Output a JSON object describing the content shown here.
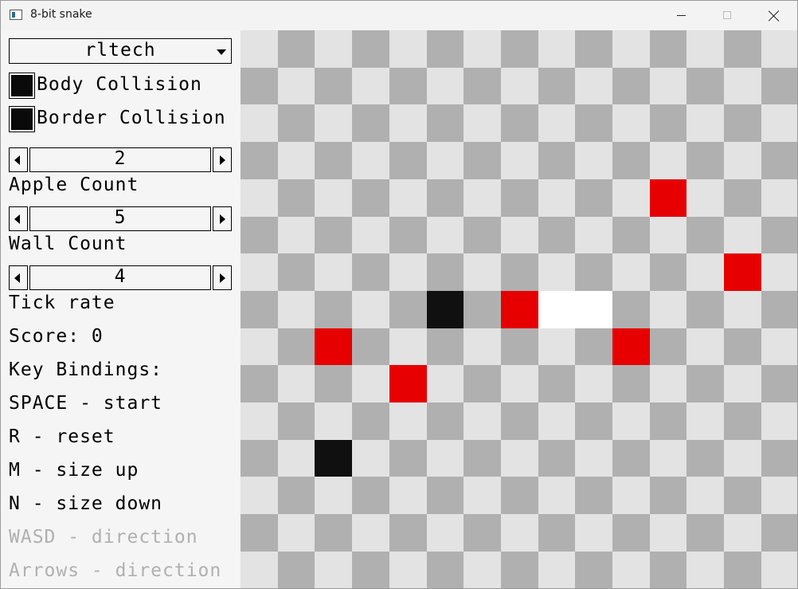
{
  "window": {
    "title": "8-bit snake"
  },
  "sidebar": {
    "dropdown": {
      "value": "rltech"
    },
    "body_collision": {
      "label": "Body Collision",
      "checked": true
    },
    "border_collision": {
      "label": "Border Collision",
      "checked": true
    },
    "apple_count": {
      "value": "2",
      "label": "Apple Count"
    },
    "wall_count": {
      "value": "5",
      "label": "Wall Count"
    },
    "tick_rate": {
      "value": "4",
      "label": "Tick rate"
    },
    "score": "Score: 0",
    "key_bindings_title": "Key Bindings:",
    "key_bindings": [
      {
        "text": "SPACE - start",
        "disabled": false
      },
      {
        "text": "R - reset",
        "disabled": false
      },
      {
        "text": "M - size up",
        "disabled": false
      },
      {
        "text": "N - size down",
        "disabled": false
      },
      {
        "text": "WASD - direction",
        "disabled": true
      },
      {
        "text": "Arrows - direction",
        "disabled": true
      }
    ]
  },
  "board": {
    "columns": 15,
    "rows": 15,
    "colors": {
      "light": "#e3e3e3",
      "dark": "#b0b0b0",
      "apple": "#e60000",
      "wall": "#101010",
      "snake": "#ffffff"
    },
    "apples": [
      [
        11,
        4
      ],
      [
        13,
        6
      ],
      [
        7,
        7
      ],
      [
        2,
        8
      ],
      [
        10,
        8
      ],
      [
        4,
        9
      ]
    ],
    "walls": [
      [
        5,
        7
      ],
      [
        2,
        11
      ]
    ],
    "snake": [
      [
        8,
        7
      ],
      [
        9,
        7
      ]
    ]
  }
}
